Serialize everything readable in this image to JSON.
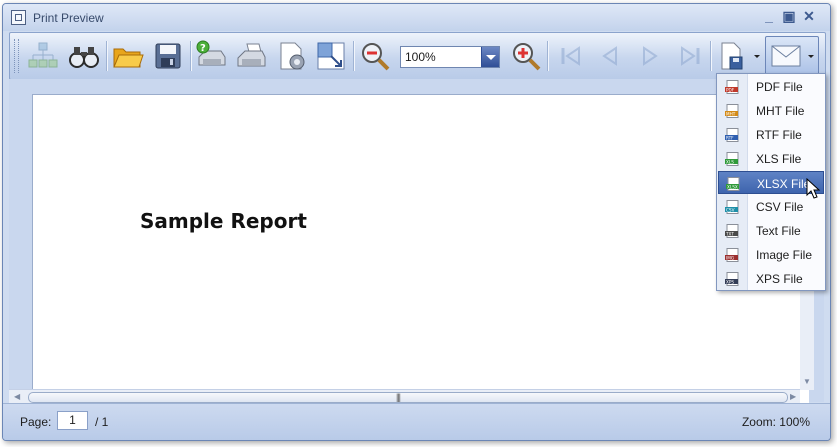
{
  "window": {
    "title": "Print Preview"
  },
  "toolbar": {
    "zoom_value": "100%"
  },
  "report": {
    "title": "Sample Report"
  },
  "status": {
    "page_label": "Page:",
    "page_value": "1",
    "page_total": "/ 1",
    "zoom": "Zoom: 100%"
  },
  "scrollbar": {
    "grip": "|||"
  },
  "export_menu": {
    "items": [
      {
        "label": "PDF File",
        "icon": "pdf-file-icon",
        "tag": "PDF",
        "color": "#c0392b"
      },
      {
        "label": "MHT File",
        "icon": "mht-file-icon",
        "tag": "MHT",
        "color": "#d38a16"
      },
      {
        "label": "RTF File",
        "icon": "rtf-file-icon",
        "tag": "RTF",
        "color": "#2f5fb0"
      },
      {
        "label": "XLS File",
        "icon": "xls-file-icon",
        "tag": "XLS",
        "color": "#2f9a3a"
      },
      {
        "label": "XLSX File",
        "icon": "xlsx-file-icon",
        "tag": "XLSX",
        "color": "#2f9a3a",
        "selected": true
      },
      {
        "label": "CSV File",
        "icon": "csv-file-icon",
        "tag": "CSV",
        "color": "#1e8fa8"
      },
      {
        "label": "Text File",
        "icon": "text-file-icon",
        "tag": "TXT",
        "color": "#4a4a4a"
      },
      {
        "label": "Image File",
        "icon": "image-file-icon",
        "tag": "IMG",
        "color": "#9b2f2f"
      },
      {
        "label": "XPS File",
        "icon": "xps-file-icon",
        "tag": "XPS",
        "color": "#333d57"
      }
    ]
  },
  "colors": {
    "selection": "#3e64ad",
    "titlebar": "#c3d3ec",
    "toolbar": "#c7d6ee"
  }
}
